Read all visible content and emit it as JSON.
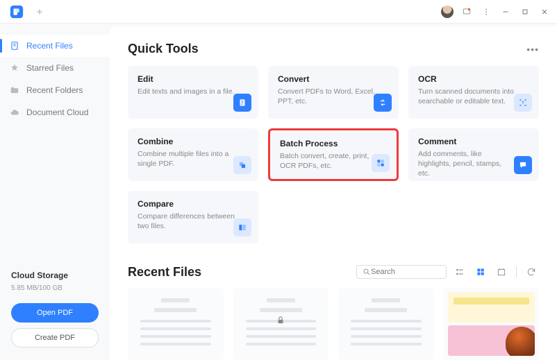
{
  "sidebar": {
    "items": [
      {
        "label": "Recent Files",
        "icon": "recent"
      },
      {
        "label": "Starred Files",
        "icon": "star"
      },
      {
        "label": "Recent Folders",
        "icon": "folder"
      },
      {
        "label": "Document Cloud",
        "icon": "cloud"
      }
    ],
    "cloud_storage_title": "Cloud Storage",
    "cloud_storage_usage": "5.85 MB/100 GB",
    "open_pdf_label": "Open PDF",
    "create_pdf_label": "Create PDF"
  },
  "quick_tools": {
    "title": "Quick Tools",
    "tools": [
      {
        "title": "Edit",
        "desc": "Edit texts and images in a file."
      },
      {
        "title": "Convert",
        "desc": "Convert PDFs to Word, Excel, PPT, etc."
      },
      {
        "title": "OCR",
        "desc": "Turn scanned documents into searchable or editable text."
      },
      {
        "title": "Combine",
        "desc": "Combine multiple files into a single PDF."
      },
      {
        "title": "Batch Process",
        "desc": "Batch convert, create, print, OCR PDFs, etc."
      },
      {
        "title": "Comment",
        "desc": "Add comments, like highlights, pencil, stamps, etc."
      },
      {
        "title": "Compare",
        "desc": "Compare differences between two files."
      }
    ]
  },
  "recent_files": {
    "title": "Recent Files",
    "search_placeholder": "Search"
  }
}
